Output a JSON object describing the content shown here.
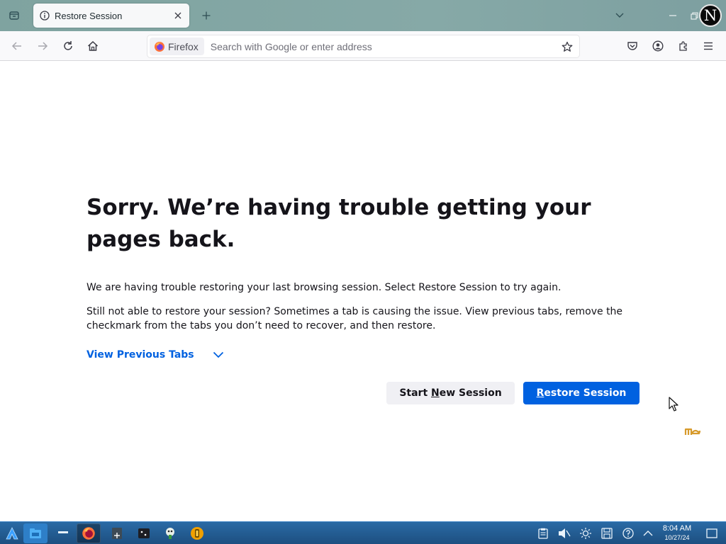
{
  "window": {
    "tab_title": "Restore Session",
    "avatar_letter": "N"
  },
  "toolbar": {
    "identity_label": "Firefox",
    "url_placeholder": "Search with Google or enter address"
  },
  "page": {
    "title": "Sorry. We’re having trouble getting your pages back.",
    "paragraph_1": "We are having trouble restoring your last browsing session. Select Restore Session to try again.",
    "paragraph_2": "Still not able to restore your session? Sometimes a tab is causing the issue. View previous tabs, remove the checkmark from the tabs you don’t need to recover, and then restore.",
    "view_previous_label": "View Previous Tabs",
    "start_new": {
      "pre": "Start ",
      "key": "N",
      "post": "ew Session"
    },
    "restore": {
      "pre": "",
      "key": "R",
      "post": "estore Session"
    }
  },
  "taskbar": {
    "time": "8:04 AM",
    "date": "10/27/24"
  },
  "colors": {
    "accent": "#0061e0",
    "taskbar": "#245e95",
    "titlebar": "#82a6a4"
  },
  "icons": [
    "list-all-tabs-icon",
    "info-icon",
    "close-icon",
    "plus-icon",
    "chevron-down-icon",
    "minimize-icon",
    "restore-icon",
    "back-arrow-icon",
    "forward-arrow-icon",
    "reload-icon",
    "home-icon",
    "firefox-logo-icon",
    "star-icon",
    "pocket-icon",
    "account-icon",
    "extensions-icon",
    "menu-icon",
    "app-launcher-icon",
    "files-icon",
    "terminal-icon",
    "clipboard-icon",
    "volume-icon",
    "brightness-icon",
    "save-icon",
    "help-icon",
    "show-desktop-icon"
  ]
}
